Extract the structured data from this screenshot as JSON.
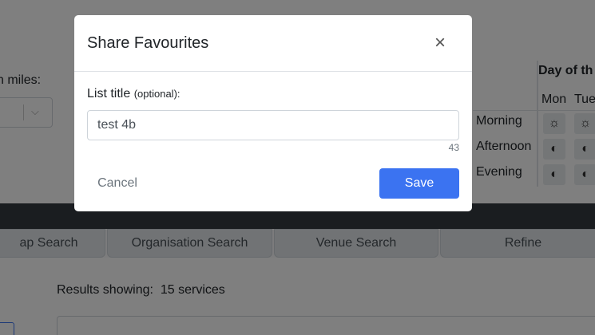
{
  "background": {
    "miles_label": "n miles:",
    "chevron_glyph": "⌵",
    "day_of_week": {
      "header": "Day of th",
      "columns": [
        "Mon",
        "Tue"
      ],
      "rows": [
        "Morning",
        "Afternoon",
        "Evening"
      ],
      "cell_icon": "sun-icon"
    },
    "tabs": [
      "ap Search",
      "Organisation Search",
      "Venue Search",
      "Refine"
    ],
    "results_label": "Results showing:",
    "results_count": "15 services"
  },
  "modal": {
    "title": "Share Favourites",
    "close_glyph": "×",
    "list_title_label": "List title",
    "list_title_optional": "(optional):",
    "list_title_value": "test 4b",
    "char_count": "43",
    "cancel_label": "Cancel",
    "save_label": "Save"
  },
  "colors": {
    "primary": "#3b73f1",
    "navbar": "#343a40",
    "overlay": "rgba(0,0,0,0.5)"
  }
}
